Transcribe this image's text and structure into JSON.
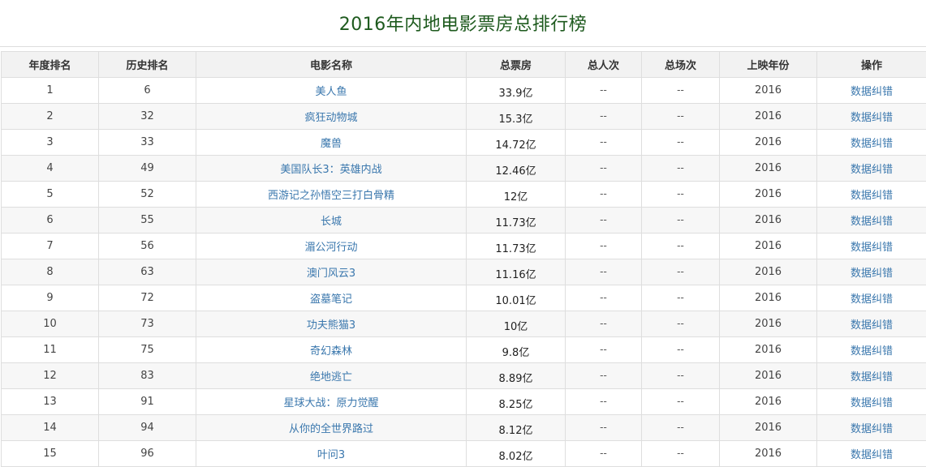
{
  "page": {
    "title": "2016年内地电影票房总排行榜"
  },
  "table": {
    "headers": {
      "year_rank": "年度排名",
      "history_rank": "历史排名",
      "movie_name": "电影名称",
      "total_box_office": "总票房",
      "total_viewers": "总人次",
      "total_screenings": "总场次",
      "release_year": "上映年份",
      "action": "操作"
    },
    "rows": [
      {
        "year_rank": "1",
        "history_rank": "6",
        "movie_name": "美人鱼",
        "total_box_office": "33.9亿",
        "total_viewers": "--",
        "total_screenings": "--",
        "release_year": "2016",
        "action": "数据纠错"
      },
      {
        "year_rank": "2",
        "history_rank": "32",
        "movie_name": "疯狂动物城",
        "total_box_office": "15.3亿",
        "total_viewers": "--",
        "total_screenings": "--",
        "release_year": "2016",
        "action": "数据纠错"
      },
      {
        "year_rank": "3",
        "history_rank": "33",
        "movie_name": "魔兽",
        "total_box_office": "14.72亿",
        "total_viewers": "--",
        "total_screenings": "--",
        "release_year": "2016",
        "action": "数据纠错"
      },
      {
        "year_rank": "4",
        "history_rank": "49",
        "movie_name": "美国队长3：英雄内战",
        "total_box_office": "12.46亿",
        "total_viewers": "--",
        "total_screenings": "--",
        "release_year": "2016",
        "action": "数据纠错"
      },
      {
        "year_rank": "5",
        "history_rank": "52",
        "movie_name": "西游记之孙悟空三打白骨精",
        "total_box_office": "12亿",
        "total_viewers": "--",
        "total_screenings": "--",
        "release_year": "2016",
        "action": "数据纠错"
      },
      {
        "year_rank": "6",
        "history_rank": "55",
        "movie_name": "长城",
        "total_box_office": "11.73亿",
        "total_viewers": "--",
        "total_screenings": "--",
        "release_year": "2016",
        "action": "数据纠错"
      },
      {
        "year_rank": "7",
        "history_rank": "56",
        "movie_name": "湄公河行动",
        "total_box_office": "11.73亿",
        "total_viewers": "--",
        "total_screenings": "--",
        "release_year": "2016",
        "action": "数据纠错"
      },
      {
        "year_rank": "8",
        "history_rank": "63",
        "movie_name": "澳门风云3",
        "total_box_office": "11.16亿",
        "total_viewers": "--",
        "total_screenings": "--",
        "release_year": "2016",
        "action": "数据纠错"
      },
      {
        "year_rank": "9",
        "history_rank": "72",
        "movie_name": "盗墓笔记",
        "total_box_office": "10.01亿",
        "total_viewers": "--",
        "total_screenings": "--",
        "release_year": "2016",
        "action": "数据纠错"
      },
      {
        "year_rank": "10",
        "history_rank": "73",
        "movie_name": "功夫熊猫3",
        "total_box_office": "10亿",
        "total_viewers": "--",
        "total_screenings": "--",
        "release_year": "2016",
        "action": "数据纠错"
      },
      {
        "year_rank": "11",
        "history_rank": "75",
        "movie_name": "奇幻森林",
        "total_box_office": "9.8亿",
        "total_viewers": "--",
        "total_screenings": "--",
        "release_year": "2016",
        "action": "数据纠错"
      },
      {
        "year_rank": "12",
        "history_rank": "83",
        "movie_name": "绝地逃亡",
        "total_box_office": "8.89亿",
        "total_viewers": "--",
        "total_screenings": "--",
        "release_year": "2016",
        "action": "数据纠错"
      },
      {
        "year_rank": "13",
        "history_rank": "91",
        "movie_name": "星球大战：原力觉醒",
        "total_box_office": "8.25亿",
        "total_viewers": "--",
        "total_screenings": "--",
        "release_year": "2016",
        "action": "数据纠错"
      },
      {
        "year_rank": "14",
        "history_rank": "94",
        "movie_name": "从你的全世界路过",
        "total_box_office": "8.12亿",
        "total_viewers": "--",
        "total_screenings": "--",
        "release_year": "2016",
        "action": "数据纠错"
      },
      {
        "year_rank": "15",
        "history_rank": "96",
        "movie_name": "叶问3",
        "total_box_office": "8.02亿",
        "total_viewers": "--",
        "total_screenings": "--",
        "release_year": "2016",
        "action": "数据纠错"
      }
    ]
  },
  "colors": {
    "title": "#1e5a1e",
    "link": "#3a77ad",
    "header_bg": "#f2f2f2",
    "stripe_bg": "#f7f7f7",
    "border": "#dedede"
  }
}
